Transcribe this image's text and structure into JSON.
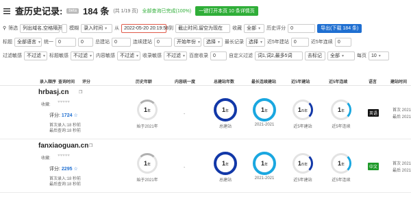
{
  "header": {
    "title": "查历史记录:",
    "beta": "beta",
    "count": "184 条",
    "pages": "(共 1/19 页)",
    "status": "全部查询已完成(100%)",
    "open_btn": "一键打开本页 10 条详情页"
  },
  "filters1": {
    "label": "筛选",
    "mode": "列出域名,空格隔开",
    "fuzzy": "模糊",
    "sort_label": "录入时间",
    "from": "从",
    "date": "2022-05-20 20:19:58",
    "to": "到",
    "end_placeholder": "截止时间,留空为现在",
    "collect_label": "收藏",
    "collect_val": "全部",
    "hist_label": "历史评分",
    "hist_val": "0",
    "export": "导出(下载 184 条)"
  },
  "filters2": {
    "title_label": "标题",
    "title_val": "全部语言",
    "col2_label": "统一",
    "col2_val": "0",
    "col3_val": "0",
    "total_label": "总建站",
    "col4_val": "0",
    "cont_label": "连续建站",
    "col5_val": "0",
    "start_label": "开始年份",
    "start_val": "开始年份",
    "sel_label": "选择",
    "rec_label": "最长记录",
    "rec_val": "选择",
    "near_label": "近5年建站",
    "near_val": "0",
    "near5_label": "近5年连续",
    "near5_val": "0"
  },
  "filters3": {
    "f1_label": "过滤敏感",
    "f1_val": "不过滤",
    "f2_label": "标题敏感",
    "f2_val": "不过滤",
    "f3_label": "内容敏感",
    "f3_val": "不过滤",
    "f4_label": "收录敏感",
    "f4_val": "不过滤",
    "f5_label": "百度收录",
    "f5_val": "0",
    "f6_label": "自定义过滤",
    "f6_val": "词1,词2,最多5词",
    "mark_btn": "去标记",
    "mark_sel": "全部",
    "page_label": "每页",
    "page_val": "10"
  },
  "table": {
    "h1": "录入顺序",
    "h2": "查询时间",
    "h3": "评分",
    "h4": "历史年龄",
    "h5": "内容统一度",
    "h6": "总建站年数",
    "h7": "最长连续建站",
    "h8": "近5年建站",
    "h9": "近5年连续",
    "h10": "语言",
    "h11": "建站时间"
  },
  "records": [
    {
      "domain": "hrbasj.cn",
      "collect": "收藏:",
      "score_label": "评分:",
      "score": "1724",
      "entry": "首次录入:18 秒前",
      "query": "最后查询:18 秒前",
      "age": "1",
      "age_unit": "年",
      "age_cap": "始于2021年",
      "dash": "-",
      "total": "1",
      "total_unit": "年",
      "total_cap": "总建站",
      "longest": "1",
      "longest_unit": "年",
      "longest_cap": "2021-2021",
      "near": "1",
      "near_unit": "/5年",
      "near_cap": "近5年建站",
      "near_c": "1",
      "near_c_unit": "年",
      "near_c_cap": "近5年连续",
      "lang": "英语",
      "lang_color": "#111111",
      "time1": "首次 2021",
      "time2": "最后 2021"
    },
    {
      "domain": "fanxiaoguan.cn",
      "collect": "收藏:",
      "score_label": "评分:",
      "score": "2295",
      "entry": "首次录入:18 秒前",
      "query": "最后查询:18 秒前",
      "age": "1",
      "age_unit": "年",
      "age_cap": "始于2021年",
      "dash": "-",
      "total": "1",
      "total_unit": "年",
      "total_cap": "总建站",
      "longest": "1",
      "longest_unit": "年",
      "longest_cap": "2021-2021",
      "near": "1",
      "near_unit": "/5年",
      "near_cap": "近5年建站",
      "near_c": "1",
      "near_c_unit": "年",
      "near_c_cap": "近5年连续",
      "lang": "中文",
      "lang_color": "#1f9a2a",
      "time1": "首次 2021",
      "time2": "最后 2021"
    }
  ]
}
